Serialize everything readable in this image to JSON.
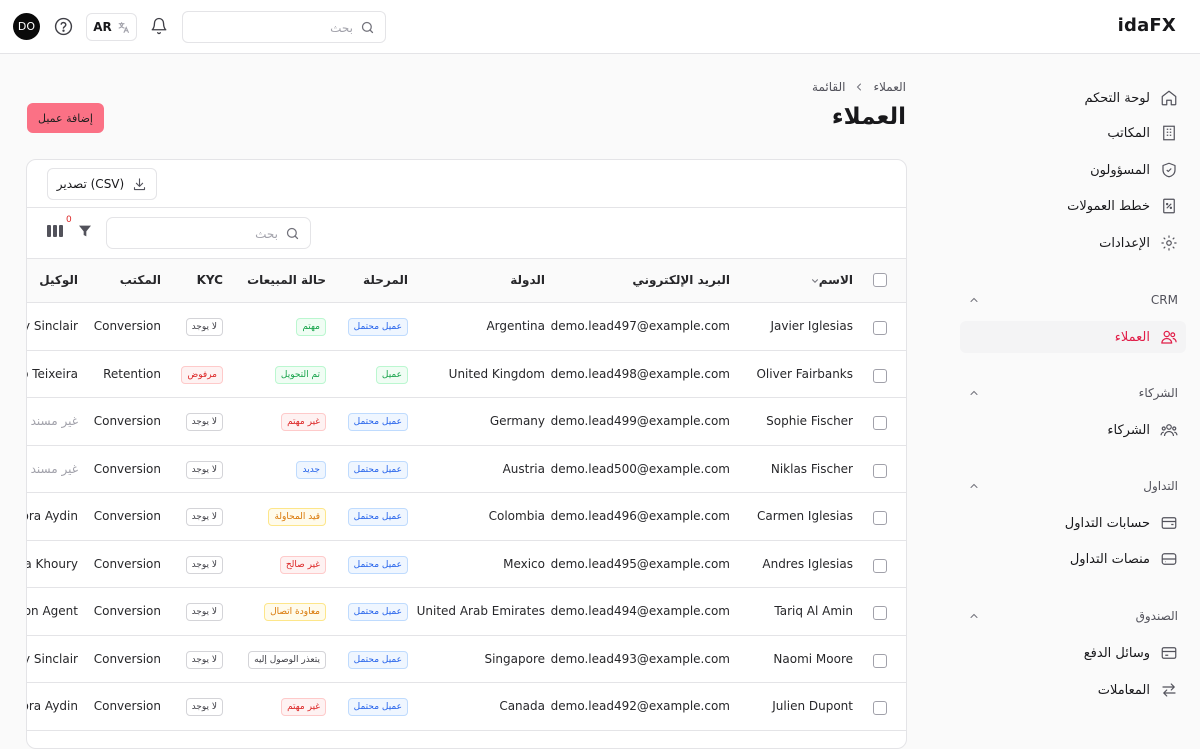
{
  "header": {
    "brand": "idaFX",
    "avatar_initials": "DO",
    "lang": "AR",
    "search_placeholder": "بحث"
  },
  "sidebar": {
    "items": [
      {
        "label": "لوحة التحكم",
        "icon": "home-icon"
      },
      {
        "label": "المكاتب",
        "icon": "building-icon"
      },
      {
        "label": "المسؤولون",
        "icon": "shield-icon"
      },
      {
        "label": "خطط العمولات",
        "icon": "percent-file-icon"
      },
      {
        "label": "الإعدادات",
        "icon": "gear-icon"
      }
    ],
    "sections": [
      {
        "title": "CRM",
        "items": [
          {
            "label": "العملاء",
            "icon": "users-icon",
            "active": true
          }
        ]
      },
      {
        "title": "الشركاء",
        "items": [
          {
            "label": "الشركاء",
            "icon": "partners-icon"
          }
        ]
      },
      {
        "title": "التداول",
        "items": [
          {
            "label": "حسابات التداول",
            "icon": "wallet-icon"
          },
          {
            "label": "منصات التداول",
            "icon": "server-icon"
          }
        ]
      },
      {
        "title": "الصندوق",
        "items": [
          {
            "label": "وسائل الدفع",
            "icon": "credit-card-icon"
          },
          {
            "label": "المعاملات",
            "icon": "arrows-icon"
          }
        ]
      }
    ]
  },
  "main": {
    "breadcrumb": [
      "العملاء",
      "القائمة"
    ],
    "title": "العملاء",
    "add_button": "إضافة عميل",
    "export_button": "تصدير (CSV)",
    "search_placeholder": "بحث",
    "filter_count": "0",
    "columns": {
      "name": "الاسم",
      "email": "البريد الإلكتروني",
      "country": "الدولة",
      "stage": "المرحلة",
      "sales_status": "حالة المبيعات",
      "kyc": "KYC",
      "desk": "المكتب",
      "agent": "الوكيل"
    },
    "rows": [
      {
        "name": "Javier Iglesias",
        "email": "demo.lead497@example.com",
        "country": "Argentina",
        "stage": "عميل محتمل",
        "stage_color": "blue",
        "status": "مهتم",
        "status_color": "green",
        "kyc": "لا يوجد",
        "kyc_color": "gray",
        "desk": "Conversion",
        "agent": "Jeremy Sinclair",
        "agent_muted": false
      },
      {
        "name": "Oliver Fairbanks",
        "email": "demo.lead498@example.com",
        "country": "United Kingdom",
        "stage": "عميل",
        "stage_color": "green",
        "status": "تم التحويل",
        "status_color": "green",
        "kyc": "مرفوض",
        "kyc_color": "red",
        "desk": "Retention",
        "agent": "Paulo Teixeira",
        "agent_muted": false
      },
      {
        "name": "Sophie Fischer",
        "email": "demo.lead499@example.com",
        "country": "Germany",
        "stage": "عميل محتمل",
        "stage_color": "blue",
        "status": "غير مهتم",
        "status_color": "red",
        "kyc": "لا يوجد",
        "kyc_color": "gray",
        "desk": "Conversion",
        "agent": "غير مسند",
        "agent_muted": true
      },
      {
        "name": "Niklas Fischer",
        "email": "demo.lead500@example.com",
        "country": "Austria",
        "stage": "عميل محتمل",
        "stage_color": "blue",
        "status": "جديد",
        "status_color": "blue",
        "kyc": "لا يوجد",
        "kyc_color": "gray",
        "desk": "Conversion",
        "agent": "غير مسند",
        "agent_muted": true
      },
      {
        "name": "Carmen Iglesias",
        "email": "demo.lead496@example.com",
        "country": "Colombia",
        "stage": "عميل محتمل",
        "stage_color": "blue",
        "status": "قيد المحاولة",
        "status_color": "orange",
        "kyc": "لا يوجد",
        "kyc_color": "gray",
        "desk": "Conversion",
        "agent": "Nora Aydin",
        "agent_muted": false
      },
      {
        "name": "Andres Iglesias",
        "email": "demo.lead495@example.com",
        "country": "Mexico",
        "stage": "عميل محتمل",
        "stage_color": "blue",
        "status": "غير صالح",
        "status_color": "red",
        "kyc": "لا يوجد",
        "kyc_color": "gray",
        "desk": "Conversion",
        "agent": "Rania Khoury",
        "agent_muted": false
      },
      {
        "name": "Tariq Al Amin",
        "email": "demo.lead494@example.com",
        "country": "United Arab Emirates",
        "stage": "عميل محتمل",
        "stage_color": "blue",
        "status": "معاودة اتصال",
        "status_color": "orange",
        "kyc": "لا يوجد",
        "kyc_color": "gray",
        "desk": "Conversion",
        "agent": "Conversion Agent",
        "agent_muted": false
      },
      {
        "name": "Naomi Moore",
        "email": "demo.lead493@example.com",
        "country": "Singapore",
        "stage": "عميل محتمل",
        "stage_color": "blue",
        "status": "يتعذر الوصول إليه",
        "status_color": "gray",
        "kyc": "لا يوجد",
        "kyc_color": "gray",
        "desk": "Conversion",
        "agent": "Jeremy Sinclair",
        "agent_muted": false
      },
      {
        "name": "Julien Dupont",
        "email": "demo.lead492@example.com",
        "country": "Canada",
        "stage": "عميل محتمل",
        "stage_color": "blue",
        "status": "غير مهتم",
        "status_color": "red",
        "kyc": "لا يوجد",
        "kyc_color": "gray",
        "desk": "Conversion",
        "agent": "Nora Aydin",
        "agent_muted": false
      }
    ]
  }
}
